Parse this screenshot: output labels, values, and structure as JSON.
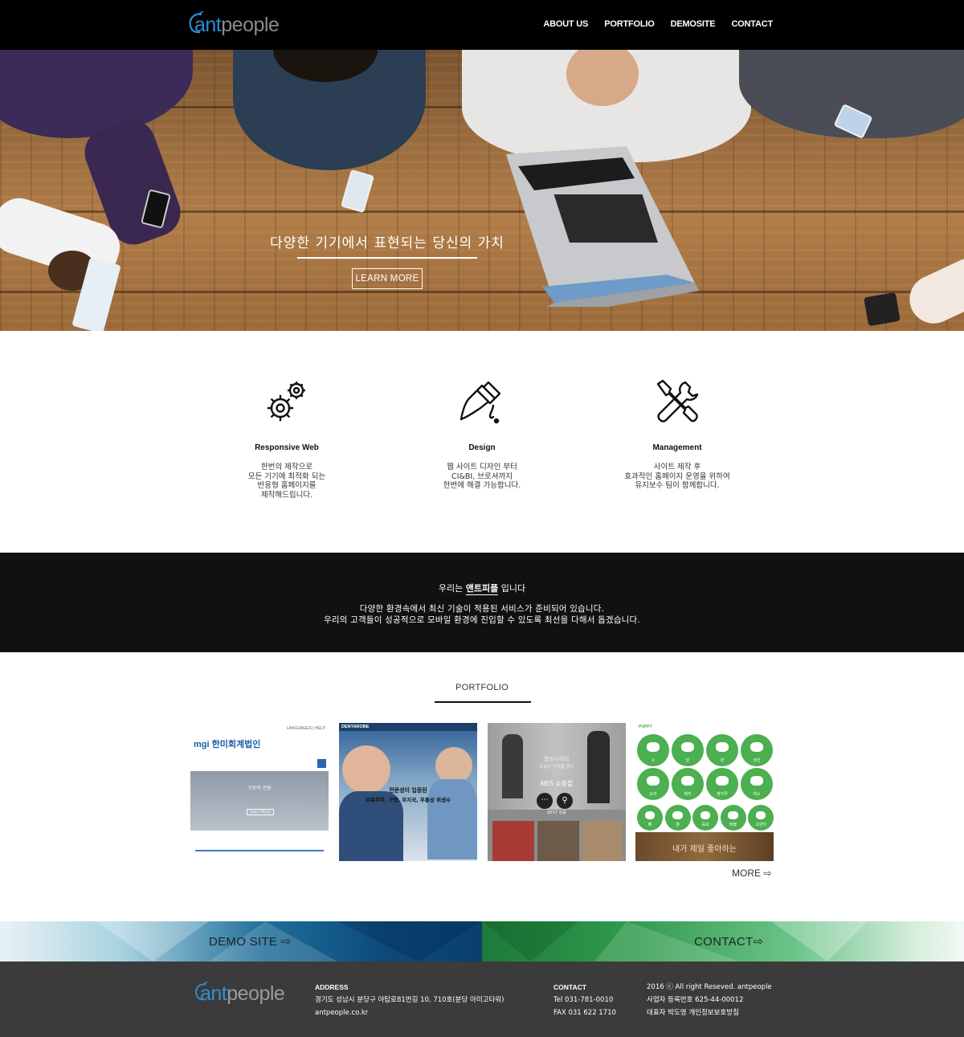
{
  "header": {
    "logo": {
      "ant": "ant",
      "people": "people"
    },
    "nav": [
      "ABOUT US",
      "PORTFOLIO",
      "DEMOSITE",
      "CONTACT"
    ]
  },
  "hero": {
    "title": "다양한 기기에서 표현되는 당신의 가치",
    "button": "LEARN MORE"
  },
  "features": [
    {
      "icon": "gears-icon",
      "title": "Responsive Web",
      "desc": "한번의 제작으로\n모든 기기에 최적화 되는\n반응형 홈페이지를\n제작해드립니다."
    },
    {
      "icon": "paint-brush-icon",
      "title": "Design",
      "desc": "웹 사이트 디자인 부터\nCI&BI, 브로셔까지\n한번에 해결 가능합니다."
    },
    {
      "icon": "wrench-screwdriver-icon",
      "title": "Management",
      "desc": "사이트 제작 후\n효과적인 홈페이지 운영을 위하여\n유지보수 팀이 함께합니다."
    }
  ],
  "about": {
    "prefix": "우리는 ",
    "brand": "앤트피플",
    "suffix": " 입니다",
    "text": "다양한 환경속에서 최신 기술이 적용된 서비스가 준비되어 있습니다.\n우리의 고객들이 성공적으로 모바일 환경에 진입할 수 있도록 최선을 다해서 돕겠습니다."
  },
  "portfolio": {
    "heading": "PORTFOLIO",
    "more": "MORE",
    "items": [
      {
        "brand": "mgi 한미회계법인",
        "lang": "LANGUAGES",
        "help": "HELP",
        "banner_title": "구조와 관용",
        "banner_btn": "Learn More"
      },
      {
        "brand": "DENTAROBE",
        "caption_1": "전문성이 입증된",
        "caption_2": "무료주차, 구멍, 무지국, 무통성 위생수"
      },
      {
        "title_1": "앤소니아트",
        "title_2": "오늘이 가장을 돕다",
        "label": "NES 쇼핑몰",
        "tag": "BEST 상품"
      },
      {
        "brand": "PUPPY",
        "tiles": [
          "소",
          "닭",
          "양",
          "생선",
          "오리",
          "돼지",
          "캥거루",
          "채소",
          "뼈",
          "껌",
          "육포",
          "테블",
          "고양이"
        ],
        "banner": "내가 제일 좋아하는"
      }
    ]
  },
  "banners": {
    "demo": "DEMO SITE",
    "contact": "CONTACT"
  },
  "footer": {
    "logo": {
      "ant": "ant",
      "people": "people"
    },
    "address_h": "ADDRESS",
    "address_1": "경기도 성남시 분당구 야탑로81번길 10, 710호(분당 아미고타워)",
    "address_2": "antpeople.co.kr",
    "contact_h": "CONTACT",
    "tel": "Tel 031-781-0010",
    "fax": "FAX 031 622 1710",
    "copy": "2016 ⓒ All right Reseved. antpeople",
    "reg": "사업자 등록번호 625-44-00012",
    "rep": "대표자 박도영   개인정보보호방침"
  },
  "colors": {
    "accent": "#2f8fd4",
    "dark": "#111111",
    "footer": "#3b3b3b",
    "green": "#4caf50"
  }
}
